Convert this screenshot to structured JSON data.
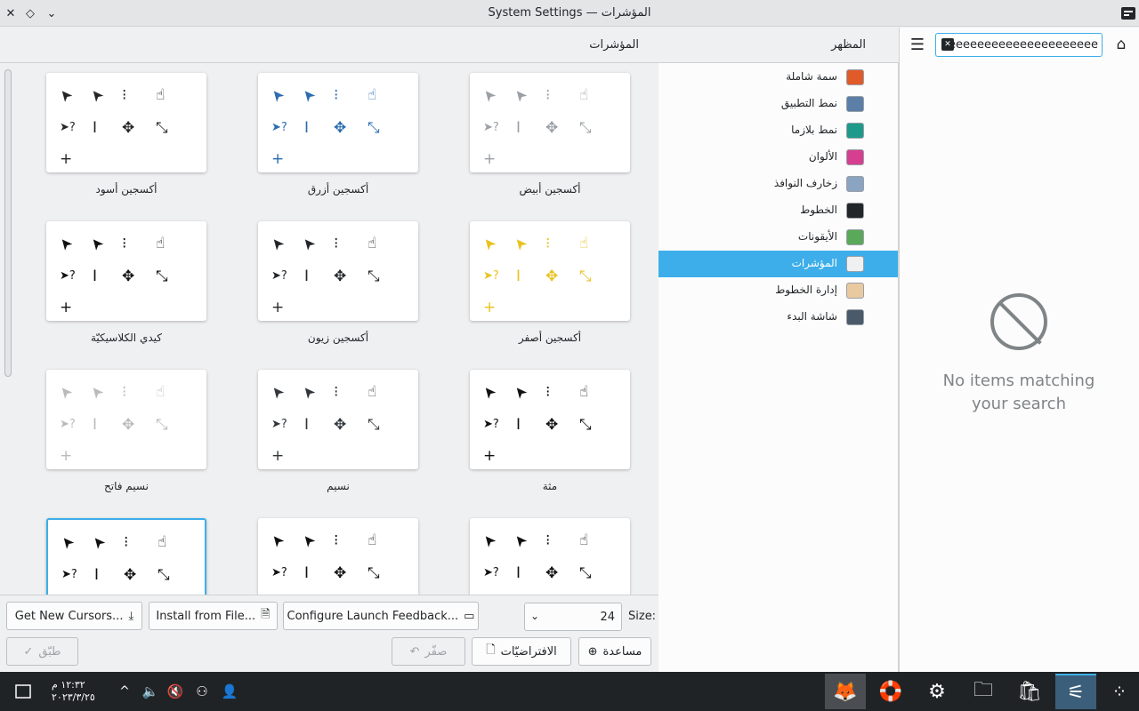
{
  "window": {
    "title": "System Settings — المؤشرات",
    "close": "✕",
    "keep_above": "◇",
    "menu": "⌄"
  },
  "sidebar": {
    "header": "المظهر",
    "search_value": "eeeeeeeeeeeeeeeeeeeee",
    "items": [
      {
        "label": "سمة شاملة",
        "icon": "global-theme-icon",
        "color": "#e05a2a"
      },
      {
        "label": "نمط التطبيق",
        "icon": "application-style-icon",
        "color": "#5b7fa6"
      },
      {
        "label": "نمط بلازما",
        "icon": "plasma-style-icon",
        "color": "#1e9a8a"
      },
      {
        "label": "الألوان",
        "icon": "colors-icon",
        "color": "#d63f8f"
      },
      {
        "label": "زخارف النوافذ",
        "icon": "window-decorations-icon",
        "color": "#8aa4c2"
      },
      {
        "label": "الخطوط",
        "icon": "fonts-icon",
        "color": "#232629"
      },
      {
        "label": "الأيقونات",
        "icon": "icons-icon",
        "color": "#5aa95a"
      },
      {
        "label": "المؤشرات",
        "icon": "cursors-icon",
        "color": "#eff0f1"
      },
      {
        "label": "إدارة الخطوط",
        "icon": "font-management-icon",
        "color": "#e8c9a0"
      },
      {
        "label": "شاشة البدء",
        "icon": "splash-screen-icon",
        "color": "#4a5a6a"
      }
    ],
    "selected_index": 7
  },
  "empty_state": {
    "line1": "No items matching",
    "line2": "your search"
  },
  "main": {
    "title": "المؤشرات",
    "themes": [
      {
        "name": "أكسجين أسود",
        "color": "#232629"
      },
      {
        "name": "أكسجين أزرق",
        "color": "#2b6cb0"
      },
      {
        "name": "أكسجين أبيض",
        "color": "#9aa0a6"
      },
      {
        "name": "كيدي الكلاسيكيّة",
        "color": "#111111"
      },
      {
        "name": "أكسجين زيون",
        "color": "#232629"
      },
      {
        "name": "أكسجين أصفر",
        "color": "#e8c21f"
      },
      {
        "name": "نسيم فاتح",
        "color": "#b8bcbf"
      },
      {
        "name": "نسيم",
        "color": "#31363b"
      },
      {
        "name": "مثة",
        "color": "#111111"
      },
      {
        "name": "",
        "color": "#111111"
      },
      {
        "name": "",
        "color": "#111111"
      },
      {
        "name": "",
        "color": "#111111"
      }
    ],
    "size_label": "Size:",
    "size_value": "24",
    "configure_feedback": "Configure Launch Feedback...",
    "install_file": "Install from File...",
    "get_new": "Get New Cursors...",
    "help": "مساعدة",
    "defaults": "الافتراضيّات",
    "reset": "صفّر",
    "apply": "طبّق"
  },
  "taskbar": {
    "time": "١٢:٣٢ م",
    "date": "٢٠٢٣/٣/٢٥",
    "apps": [
      "firefox-icon",
      "help-center-icon",
      "system-settings-icon",
      "file-manager-icon",
      "discover-icon",
      "settings-active-icon"
    ]
  }
}
